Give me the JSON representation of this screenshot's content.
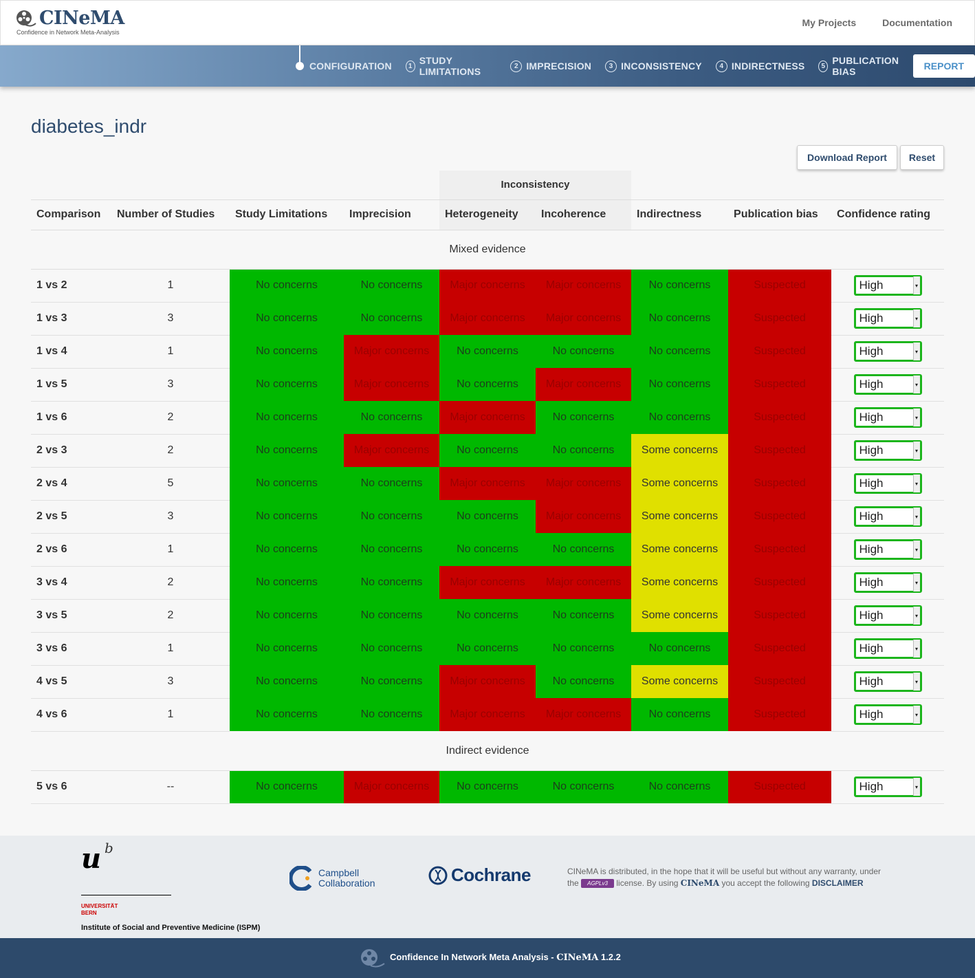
{
  "header": {
    "logo_text": "CINeMA",
    "logo_subtitle": "Confidence in Network Meta-Analysis",
    "links": [
      "My Projects",
      "Documentation"
    ]
  },
  "nav": {
    "configuration": "CONFIGURATION",
    "steps": [
      {
        "num": "1",
        "label": "STUDY LIMITATIONS"
      },
      {
        "num": "2",
        "label": "IMPRECISION"
      },
      {
        "num": "3",
        "label": "INCONSISTENCY"
      },
      {
        "num": "4",
        "label": "INDIRECTNESS"
      },
      {
        "num": "5",
        "label": "PUBLICATION BIAS"
      }
    ],
    "report": "REPORT"
  },
  "project": {
    "title": "diabetes_indr"
  },
  "buttons": {
    "download": "Download Report",
    "reset": "Reset"
  },
  "table": {
    "group_header": "Inconsistency",
    "headers": [
      "Comparison",
      "Number of Studies",
      "Study Limitations",
      "Imprecision",
      "Heterogeneity",
      "Incoherence",
      "Indirectness",
      "Publication bias",
      "Confidence rating"
    ],
    "sections": [
      {
        "title": "Mixed evidence",
        "rows": [
          {
            "comparison": "1 vs 2",
            "n": "1",
            "sl": "No concerns",
            "imp": "No concerns",
            "het": "Major concerns",
            "inc": "Major concerns",
            "ind": "No concerns",
            "pb": "Suspected",
            "rating": "High"
          },
          {
            "comparison": "1 vs 3",
            "n": "3",
            "sl": "No concerns",
            "imp": "No concerns",
            "het": "Major concerns",
            "inc": "Major concerns",
            "ind": "No concerns",
            "pb": "Suspected",
            "rating": "High"
          },
          {
            "comparison": "1 vs 4",
            "n": "1",
            "sl": "No concerns",
            "imp": "Major concerns",
            "het": "No concerns",
            "inc": "No concerns",
            "ind": "No concerns",
            "pb": "Suspected",
            "rating": "High"
          },
          {
            "comparison": "1 vs 5",
            "n": "3",
            "sl": "No concerns",
            "imp": "Major concerns",
            "het": "No concerns",
            "inc": "Major concerns",
            "ind": "No concerns",
            "pb": "Suspected",
            "rating": "High"
          },
          {
            "comparison": "1 vs 6",
            "n": "2",
            "sl": "No concerns",
            "imp": "No concerns",
            "het": "Major concerns",
            "inc": "No concerns",
            "ind": "No concerns",
            "pb": "Suspected",
            "rating": "High"
          },
          {
            "comparison": "2 vs 3",
            "n": "2",
            "sl": "No concerns",
            "imp": "Major concerns",
            "het": "No concerns",
            "inc": "No concerns",
            "ind": "Some concerns",
            "pb": "Suspected",
            "rating": "High"
          },
          {
            "comparison": "2 vs 4",
            "n": "5",
            "sl": "No concerns",
            "imp": "No concerns",
            "het": "Major concerns",
            "inc": "Major concerns",
            "ind": "Some concerns",
            "pb": "Suspected",
            "rating": "High"
          },
          {
            "comparison": "2 vs 5",
            "n": "3",
            "sl": "No concerns",
            "imp": "No concerns",
            "het": "No concerns",
            "inc": "Major concerns",
            "ind": "Some concerns",
            "pb": "Suspected",
            "rating": "High"
          },
          {
            "comparison": "2 vs 6",
            "n": "1",
            "sl": "No concerns",
            "imp": "No concerns",
            "het": "No concerns",
            "inc": "No concerns",
            "ind": "Some concerns",
            "pb": "Suspected",
            "rating": "High"
          },
          {
            "comparison": "3 vs 4",
            "n": "2",
            "sl": "No concerns",
            "imp": "No concerns",
            "het": "Major concerns",
            "inc": "Major concerns",
            "ind": "Some concerns",
            "pb": "Suspected",
            "rating": "High"
          },
          {
            "comparison": "3 vs 5",
            "n": "2",
            "sl": "No concerns",
            "imp": "No concerns",
            "het": "No concerns",
            "inc": "No concerns",
            "ind": "Some concerns",
            "pb": "Suspected",
            "rating": "High"
          },
          {
            "comparison": "3 vs 6",
            "n": "1",
            "sl": "No concerns",
            "imp": "No concerns",
            "het": "No concerns",
            "inc": "No concerns",
            "ind": "No concerns",
            "pb": "Suspected",
            "rating": "High"
          },
          {
            "comparison": "4 vs 5",
            "n": "3",
            "sl": "No concerns",
            "imp": "No concerns",
            "het": "Major concerns",
            "inc": "No concerns",
            "ind": "Some concerns",
            "pb": "Suspected",
            "rating": "High"
          },
          {
            "comparison": "4 vs 6",
            "n": "1",
            "sl": "No concerns",
            "imp": "No concerns",
            "het": "Major concerns",
            "inc": "Major concerns",
            "ind": "No concerns",
            "pb": "Suspected",
            "rating": "High"
          }
        ]
      },
      {
        "title": "Indirect evidence",
        "rows": [
          {
            "comparison": "5 vs 6",
            "n": "--",
            "sl": "No concerns",
            "imp": "Major concerns",
            "het": "No concerns",
            "inc": "No concerns",
            "ind": "No concerns",
            "pb": "Suspected",
            "rating": "High"
          }
        ]
      }
    ]
  },
  "colors": {
    "no_concerns": "#00b800",
    "some_concerns": "#e0e000",
    "major_concerns": "#c70000",
    "suspected": "#c70000",
    "rating_border": "#1cb51c"
  },
  "footer": {
    "bern_u": "u",
    "bern_b": "b",
    "bern_uni": "UNIVERSITÄT",
    "bern_city": "BERN",
    "institute": "Institute of Social and Preventive Medicine (ISPM)",
    "campbell_line1": "Campbell",
    "campbell_line2": "Collaboration",
    "cochrane": "Cochrane",
    "license_1": "CINeMA is distributed, in the hope that it will be useful but without any warranty, under",
    "license_2a": "the",
    "license_badge": "AGPLv3",
    "license_2b": "license. By using",
    "license_2c": "CINeMA",
    "license_2d": "you accept the following",
    "disclaimer": "DISCLAIMER",
    "bottom_text": "Confidence In Network Meta Analysis -",
    "bottom_brand": "CINeMA",
    "version": "1.2.2"
  }
}
